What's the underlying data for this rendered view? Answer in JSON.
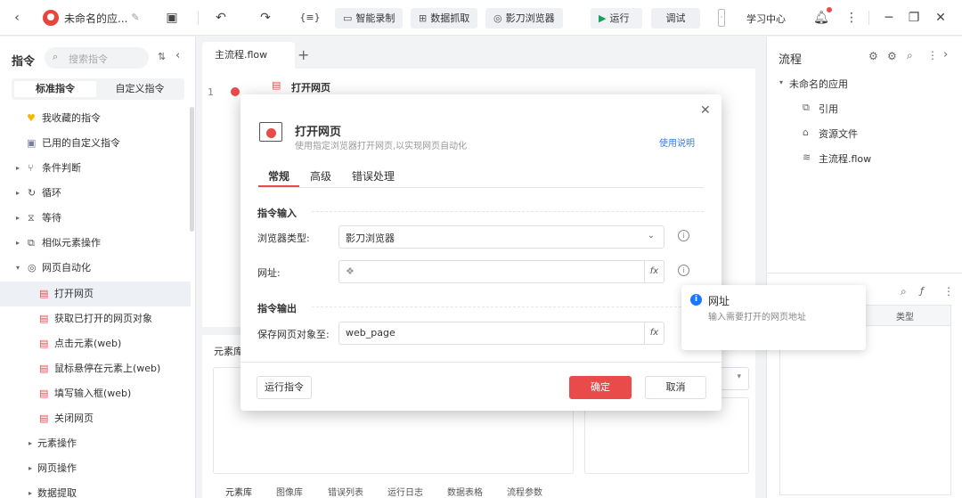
{
  "topbar": {
    "app_title": "未命名的应...",
    "smart_record": "智能录制",
    "data_capture": "数据抓取",
    "browser": "影刀浏览器",
    "run": "运行",
    "debug": "调试",
    "learning_center": "学习中心",
    "expr_glyph": "{≡}"
  },
  "left_panel": {
    "title": "指令",
    "search_placeholder": "搜索指令",
    "tabs": [
      "标准指令",
      "自定义指令"
    ],
    "items": [
      {
        "label": "我收藏的指令",
        "icon": "heart-icon"
      },
      {
        "label": "已用的自定义指令",
        "icon": "briefcase-icon"
      },
      {
        "label": "条件判断",
        "icon": "branch-icon"
      },
      {
        "label": "循环",
        "icon": "loop-icon"
      },
      {
        "label": "等待",
        "icon": "hourglass-icon"
      },
      {
        "label": "相似元素操作",
        "icon": "copy-icon"
      },
      {
        "label": "网页自动化",
        "icon": "globe-icon"
      },
      {
        "label": "打开网页",
        "icon": "browser-icon"
      },
      {
        "label": "获取已打开的网页对象",
        "icon": "browser-icon"
      },
      {
        "label": "点击元素(web)",
        "icon": "click-icon"
      },
      {
        "label": "鼠标悬停在元素上(web)",
        "icon": "hover-icon"
      },
      {
        "label": "填写输入框(web)",
        "icon": "input-icon"
      },
      {
        "label": "关闭网页",
        "icon": "browser-close-icon"
      },
      {
        "label": "元素操作",
        "icon": ""
      },
      {
        "label": "网页操作",
        "icon": ""
      },
      {
        "label": "数据提取",
        "icon": ""
      }
    ]
  },
  "editor": {
    "tab_label": "主流程.flow",
    "add_tab": "+",
    "line_number": "1",
    "step_label": "打开网页"
  },
  "bottom_panel": {
    "title": "元素库",
    "tabs": [
      "元素库",
      "图像库",
      "错误列表",
      "运行日志",
      "数据表格",
      "流程参数"
    ]
  },
  "right_panel": {
    "title": "流程",
    "tree": [
      "未命名的应用",
      "引用",
      "资源文件",
      "主流程.flow"
    ],
    "column_label": "类型"
  },
  "dialog": {
    "title": "打开网页",
    "subtitle": "使用指定浏览器打开网页,以实现网页自动化",
    "help_link": "使用说明",
    "tabs": [
      "常规",
      "高级",
      "错误处理"
    ],
    "section_input": "指令输入",
    "browser_type_label": "浏览器类型:",
    "browser_type_value": "影刀浏览器",
    "url_label": "网址:",
    "url_value": "",
    "section_output": "指令输出",
    "save_label": "保存网页对象至:",
    "save_value": "web_page",
    "run_button": "运行指令",
    "ok_button": "确定",
    "cancel_button": "取消",
    "fx_glyph": "fx"
  },
  "tooltip": {
    "title": "网址",
    "body": "输入需要打开的网页地址"
  },
  "colors": {
    "primary_red": "#e94b4b",
    "link_blue": "#3a7bd5",
    "info_blue": "#1677ff"
  }
}
